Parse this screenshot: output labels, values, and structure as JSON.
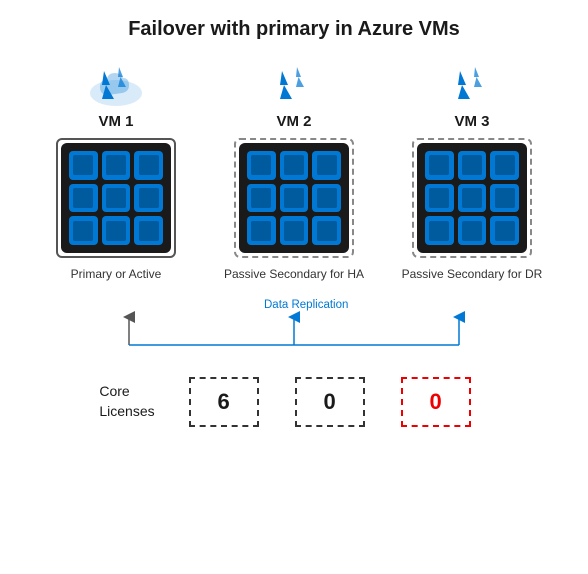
{
  "title": "Failover with primary in Azure VMs",
  "vms": [
    {
      "id": "vm1",
      "label": "VM 1",
      "border_type": "solid",
      "description": "Primary or Active"
    },
    {
      "id": "vm2",
      "label": "VM 2",
      "border_type": "dashed",
      "description": "Passive Secondary for HA"
    },
    {
      "id": "vm3",
      "label": "VM 3",
      "border_type": "dashed",
      "description": "Passive Secondary for DR"
    }
  ],
  "data_replication_label": "Data Replication",
  "licenses": {
    "label_line1": "Core",
    "label_line2": "Licenses",
    "values": [
      {
        "value": "6",
        "style": "black-dashed"
      },
      {
        "value": "0",
        "style": "black-dashed"
      },
      {
        "value": "0",
        "style": "red-dashed"
      }
    ]
  }
}
